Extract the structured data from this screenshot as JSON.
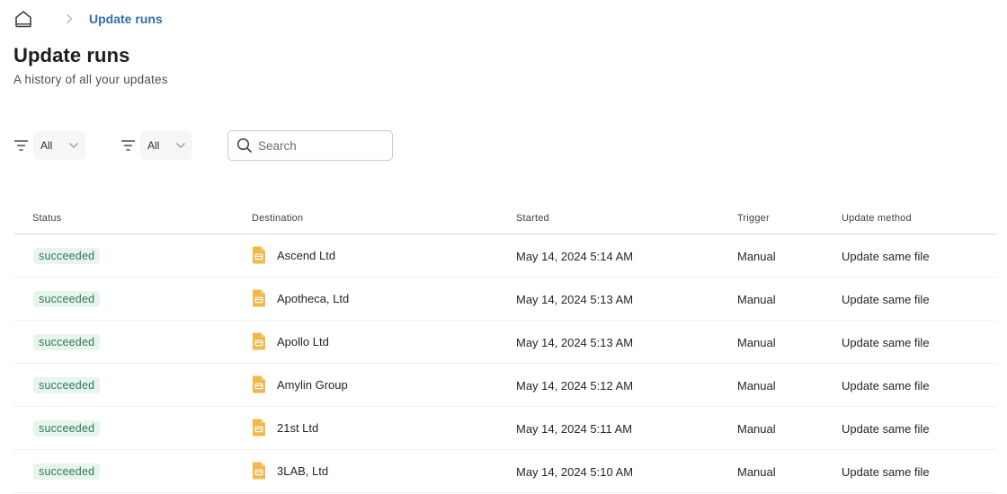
{
  "breadcrumb": {
    "current": "Update runs"
  },
  "header": {
    "title": "Update runs",
    "subtitle": "A history of all your updates"
  },
  "filters": [
    {
      "value": "All"
    },
    {
      "value": "All"
    }
  ],
  "search": {
    "placeholder": "Search",
    "value": ""
  },
  "table": {
    "columns": [
      "Status",
      "Destination",
      "Started",
      "Trigger",
      "Update method"
    ],
    "rows": [
      {
        "status": "succeeded",
        "destination": "Ascend Ltd",
        "started": "May 14, 2024 5:14 AM",
        "trigger": "Manual",
        "method": "Update same file"
      },
      {
        "status": "succeeded",
        "destination": "Apotheca, Ltd",
        "started": "May 14, 2024 5:13 AM",
        "trigger": "Manual",
        "method": "Update same file"
      },
      {
        "status": "succeeded",
        "destination": "Apollo Ltd",
        "started": "May 14, 2024 5:13 AM",
        "trigger": "Manual",
        "method": "Update same file"
      },
      {
        "status": "succeeded",
        "destination": "Amylin Group",
        "started": "May 14, 2024 5:12 AM",
        "trigger": "Manual",
        "method": "Update same file"
      },
      {
        "status": "succeeded",
        "destination": "21st Ltd",
        "started": "May 14, 2024 5:11 AM",
        "trigger": "Manual",
        "method": "Update same file"
      },
      {
        "status": "succeeded",
        "destination": "3LAB, Ltd",
        "started": "May 14, 2024 5:10 AM",
        "trigger": "Manual",
        "method": "Update same file"
      }
    ]
  },
  "icons": {
    "home": "home-icon",
    "separator": "chevron-right-icon",
    "filter": "filter-lines-icon",
    "dropdown": "chevron-down-icon",
    "search": "search-icon",
    "destination": "document-icon"
  },
  "colors": {
    "link": "#2f6fad",
    "badge_bg": "#e8f4ee",
    "badge_text": "#2f7a55",
    "doc_icon": "#f2b84b"
  }
}
